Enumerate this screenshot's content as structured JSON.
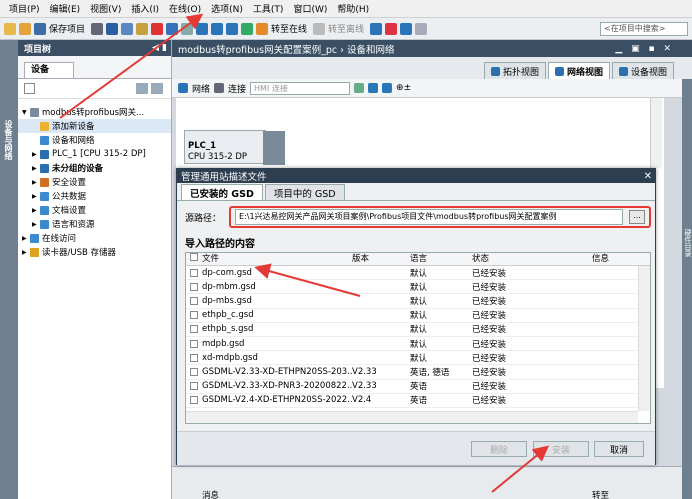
{
  "menu": [
    "项目(P)",
    "编辑(E)",
    "视图(V)",
    "插入(I)",
    "在线(O)",
    "选项(N)",
    "工具(T)",
    "窗口(W)",
    "帮助(H)"
  ],
  "toolbar": {
    "save_label": "保存项目",
    "go_online": "转至在线",
    "go_offline": "转至离线",
    "search_placeholder": "<在项目中搜索>"
  },
  "left_strip_label": "设备与网络",
  "right_strip_label": "硬件目录",
  "tree": {
    "header": "项目树",
    "tab": "设备",
    "items": [
      {
        "label": "modbus转profibus网关...",
        "indent": 0,
        "icon": "project-icon"
      },
      {
        "label": "添加新设备",
        "indent": 1,
        "icon": "add-device-icon",
        "selected": true
      },
      {
        "label": "设备和网络",
        "indent": 1,
        "icon": "network-icon"
      },
      {
        "label": "PLC_1 [CPU 315-2 DP]",
        "indent": 1,
        "icon": "plc-icon"
      },
      {
        "label": "未分组的设备",
        "indent": 1,
        "icon": "device-group-icon",
        "bold": true
      },
      {
        "label": "安全设置",
        "indent": 1,
        "icon": "security-icon"
      },
      {
        "label": "公共数据",
        "indent": 1,
        "icon": "common-data-icon"
      },
      {
        "label": "文档设置",
        "indent": 1,
        "icon": "document-icon"
      },
      {
        "label": "语言和资源",
        "indent": 1,
        "icon": "language-icon"
      },
      {
        "label": "在线访问",
        "indent": 0,
        "icon": "online-access-icon"
      },
      {
        "label": "读卡器/USB 存储器",
        "indent": 0,
        "icon": "card-reader-icon"
      }
    ]
  },
  "main": {
    "title": "modbus转profibus网关配置案例_pc › 设备和网络",
    "tabs": [
      "拓扑视图",
      "网络视图",
      "设备视图"
    ],
    "active_tab": 1,
    "net_toolbar": {
      "network": "网络",
      "connect": "连接",
      "connect_type": "HMI 连接"
    },
    "plc": {
      "name": "PLC_1",
      "cpu": "CPU 315-2 DP"
    },
    "bottom": {
      "col1": "消息",
      "col2": "转至"
    }
  },
  "dialog": {
    "title": "管理通用站描述文件",
    "tabs": [
      "已安装的 GSD",
      "项目中的 GSD"
    ],
    "source_label": "源路径：",
    "source_path": "E:\\1兴达易控网关产品网关项目案例\\Profibus项目文件\\modbus转profibus网关配置案例",
    "section": "导入路径的内容",
    "columns": [
      "文件",
      "版本",
      "语言",
      "状态",
      "信息"
    ],
    "rows": [
      [
        "dp-com.gsd",
        "",
        "默认",
        "已经安装",
        ""
      ],
      [
        "dp-mbm.gsd",
        "",
        "默认",
        "已经安装",
        ""
      ],
      [
        "dp-mbs.gsd",
        "",
        "默认",
        "已经安装",
        ""
      ],
      [
        "ethpb_c.gsd",
        "",
        "默认",
        "已经安装",
        ""
      ],
      [
        "ethpb_s.gsd",
        "",
        "默认",
        "已经安装",
        ""
      ],
      [
        "mdpb.gsd",
        "",
        "默认",
        "已经安装",
        ""
      ],
      [
        "xd-mdpb.gsd",
        "",
        "默认",
        "已经安装",
        ""
      ],
      [
        "GSDML-V2.33-XD-ETHPN20SS-203...",
        "V2.33",
        "英语, 德语",
        "已经安装",
        ""
      ],
      [
        "GSDML-V2.33-XD-PNR3-20200822...",
        "V2.33",
        "英语",
        "已经安装",
        ""
      ],
      [
        "GSDML-V2.4-XD-ETHPN20SS-2022...",
        "V2.4",
        "英语",
        "已经安装",
        ""
      ]
    ],
    "buttons": {
      "delete": "删除",
      "install": "安装",
      "cancel": "取消"
    }
  }
}
